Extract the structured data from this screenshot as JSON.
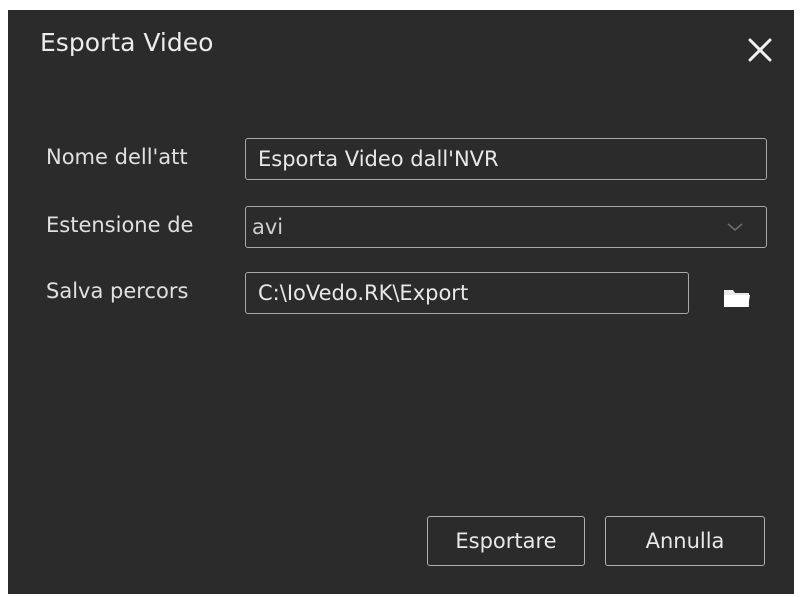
{
  "dialog": {
    "title": "Esporta Video",
    "close_icon": "close-icon"
  },
  "form": {
    "name_label": "Nome dell'att",
    "name_value": "Esporta Video dall'NVR",
    "extension_label": "Estensione de",
    "extension_value": "avi",
    "extension_icon": "chevron-down-icon",
    "path_label": "Salva percors",
    "path_value": "C:\\IoVedo.RK\\Export",
    "browse_icon": "folder-icon"
  },
  "actions": {
    "export_label": "Esportare",
    "cancel_label": "Annulla"
  },
  "colors": {
    "background": "#2b2b2b",
    "text": "#e6e6e6",
    "border": "#a9a9a9"
  }
}
